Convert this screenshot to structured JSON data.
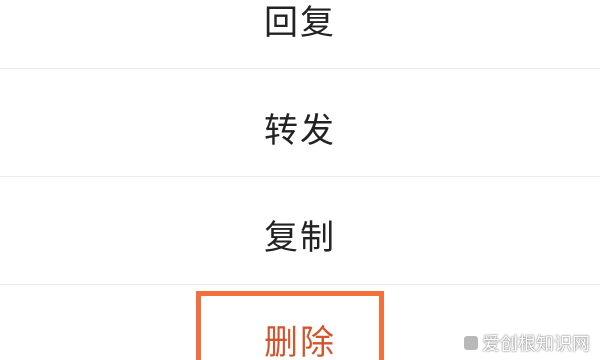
{
  "menu": {
    "items": [
      {
        "label": "回复"
      },
      {
        "label": "转发"
      },
      {
        "label": "复制"
      },
      {
        "label": "删除"
      }
    ]
  },
  "watermark": {
    "text": "爱创根知识网"
  },
  "colors": {
    "delete_text": "#d2552b",
    "highlight_border": "#f2703c",
    "divider": "#ececec"
  }
}
